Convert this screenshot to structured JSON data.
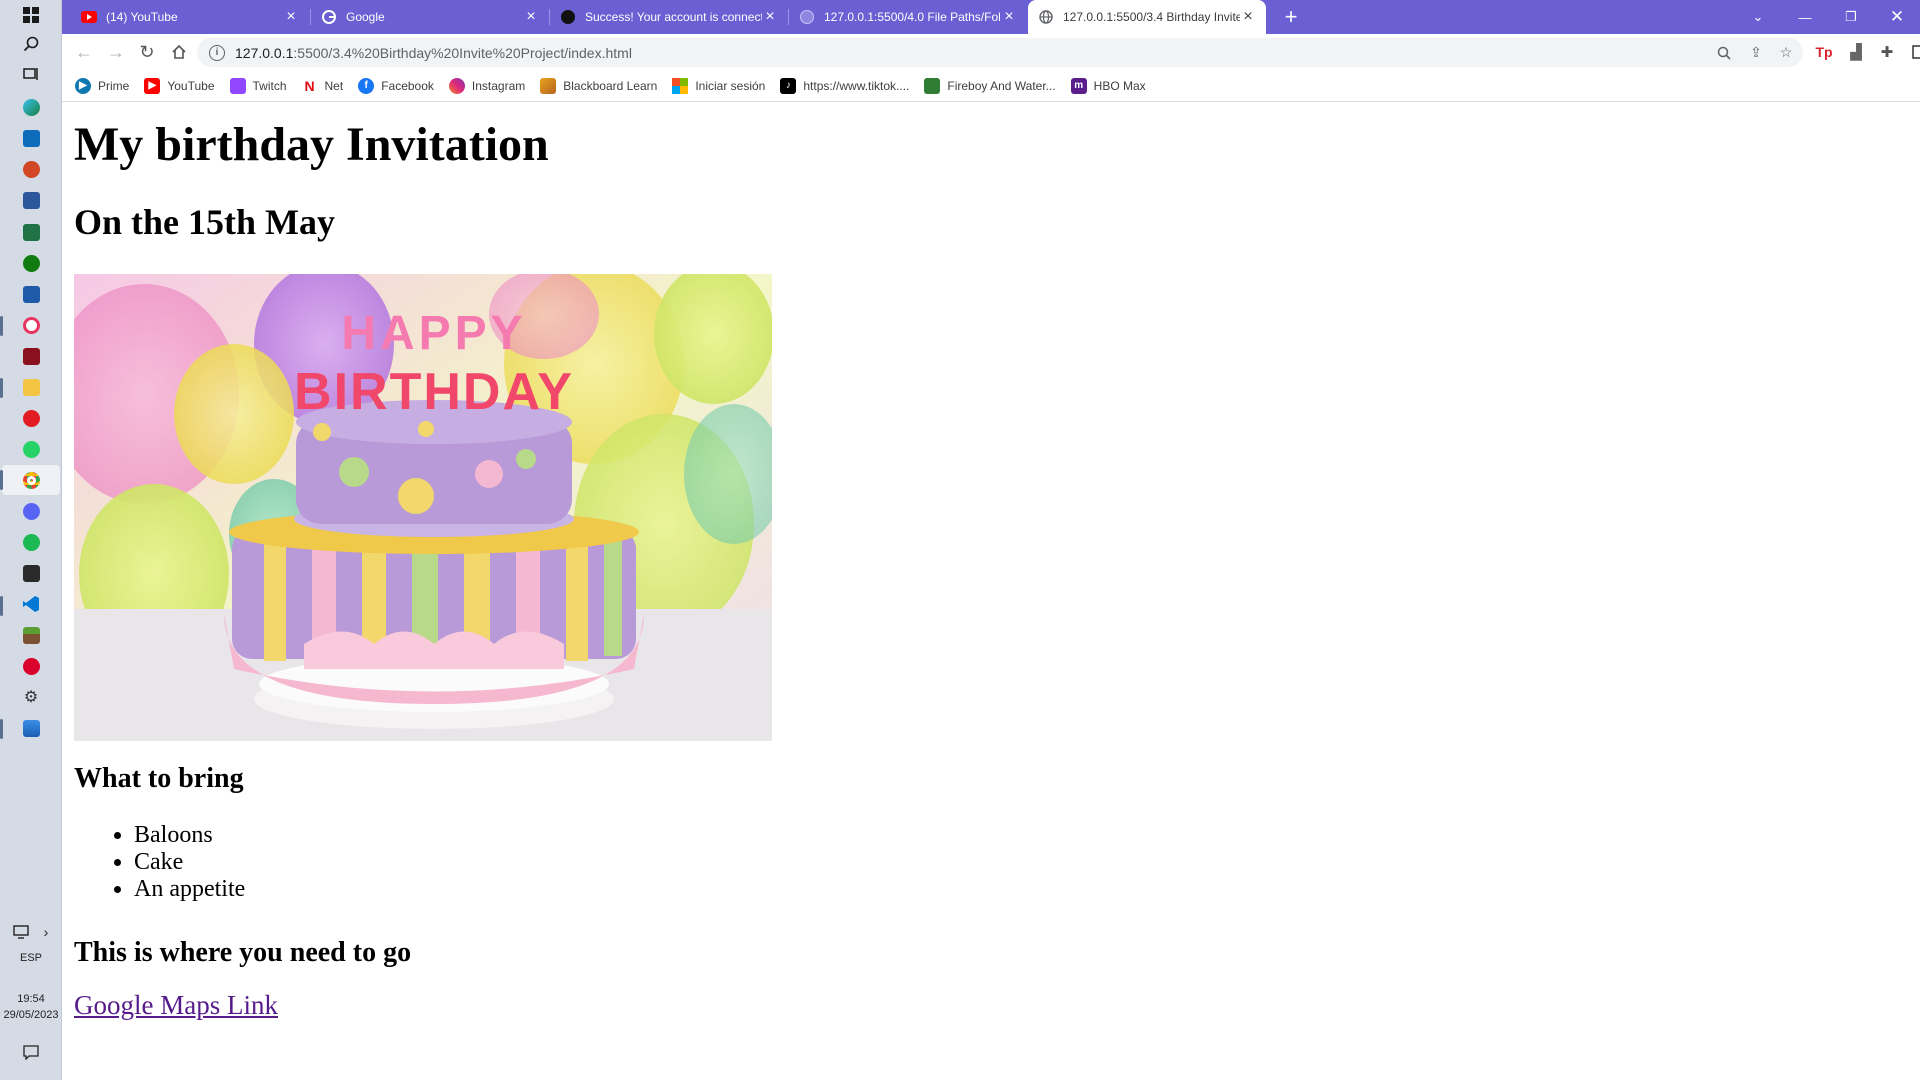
{
  "taskbar": {
    "language": "ESP",
    "time": "19:54",
    "date": "29/05/2023",
    "apps": [
      "windows-start-icon",
      "search-icon",
      "task-view-icon",
      "edge-icon",
      "outlook-icon",
      "powerpoint-icon",
      "word-icon",
      "excel-icon",
      "xbox-icon",
      "vscode-blue-icon",
      "opera-gx-icon",
      "epic-icon",
      "file-explorer-icon",
      "opera-icon",
      "whatsapp-icon",
      "chrome-icon",
      "discord-icon",
      "spotify-icon",
      "epic-games-icon",
      "visual-studio-code-icon",
      "minecraft-icon",
      "red-app-icon",
      "settings-icon",
      "photos-icon"
    ]
  },
  "browser": {
    "tabs": [
      {
        "title": "(14) YouTube",
        "icon": "youtube-icon"
      },
      {
        "title": "Google",
        "icon": "google-icon"
      },
      {
        "title": "Success! Your account is connect",
        "icon": "github-icon"
      },
      {
        "title": "127.0.0.1:5500/4.0 File Paths/Fol",
        "icon": "globe-icon"
      },
      {
        "title": "127.0.0.1:5500/3.4 Birthday Invite",
        "icon": "globe-icon",
        "active": true
      }
    ],
    "url_host": "127.0.0.1",
    "url_rest": ":5500/3.4%20Birthday%20Invite%20Project/index.html",
    "bookmarks": [
      {
        "label": "Prime",
        "icon": "prime-video-icon",
        "color": "#0f79af"
      },
      {
        "label": "YouTube",
        "icon": "youtube-icon",
        "color": "#ff0000"
      },
      {
        "label": "Twitch",
        "icon": "twitch-icon",
        "color": "#9146ff"
      },
      {
        "label": "Net",
        "icon": "netflix-icon",
        "color": "#e50914"
      },
      {
        "label": "Facebook",
        "icon": "facebook-icon",
        "color": "#1877f2"
      },
      {
        "label": "Instagram",
        "icon": "instagram-icon",
        "color": "#d6249f"
      },
      {
        "label": "Blackboard Learn",
        "icon": "blackboard-icon",
        "color": "#e8a21d"
      },
      {
        "label": "Iniciar sesión",
        "icon": "microsoft-icon",
        "color": "#f25022"
      },
      {
        "label": "https://www.tiktok....",
        "icon": "tiktok-icon",
        "color": "#000000"
      },
      {
        "label": "Fireboy And Water...",
        "icon": "fireboy-icon",
        "color": "#2e7d32"
      },
      {
        "label": "HBO Max",
        "icon": "hbo-max-icon",
        "color": "#5a1e8c"
      }
    ]
  },
  "page": {
    "title": "My birthday Invitation",
    "date": "On the 15th May",
    "bring_heading": "What to bring",
    "bring_items": [
      "Baloons",
      "Cake",
      "An appetite"
    ],
    "go_heading": "This is where you need to go",
    "maps_link": "Google Maps Link",
    "image_text": "HAPPY BIRTHDAY"
  }
}
